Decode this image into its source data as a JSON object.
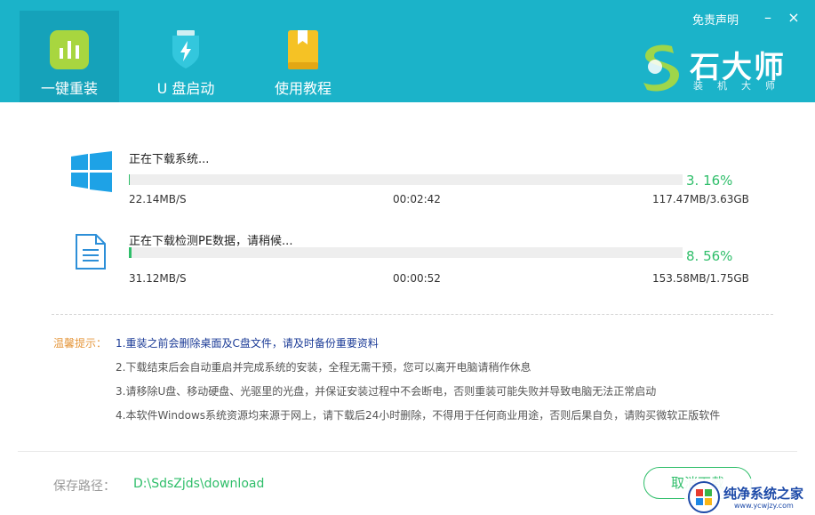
{
  "header": {
    "tabs": [
      {
        "label": "一键重装",
        "icon": "bar-chart-icon",
        "active": true
      },
      {
        "label": "U 盘启动",
        "icon": "usb-shield-icon",
        "active": false
      },
      {
        "label": "使用教程",
        "icon": "book-icon",
        "active": false
      }
    ],
    "disclaimer": "免责声明",
    "minimize": "–",
    "close": "×",
    "logo": {
      "brand": "石大师",
      "sub": "装机大师"
    }
  },
  "downloads": [
    {
      "title": "正在下载系统...",
      "icon": "windows-logo-icon",
      "percent_text": "3. 16%",
      "progress": 0.0316,
      "speed": "22.14MB/S",
      "time": "00:02:42",
      "size": "117.47MB/3.63GB"
    },
    {
      "title": "正在下载检测PE数据，请稍候...",
      "icon": "document-icon",
      "percent_text": "8. 56%",
      "progress": 0.0856,
      "speed": "31.12MB/S",
      "time": "00:00:52",
      "size": "153.58MB/1.75GB"
    }
  ],
  "tips": {
    "label": "温馨提示：",
    "items": [
      "1.重装之前会删除桌面及C盘文件，请及时备份重要资料",
      "2.下载结束后会自动重启并完成系统的安装，全程无需干预，您可以离开电脑请稍作休息",
      "3.请移除U盘、移动硬盘、光驱里的光盘，并保证安装过程中不会断电，否则重装可能失败并导致电脑无法正常启动",
      "4.本软件Windows系统资源均来源于网上，请下载后24小时删除，不得用于任何商业用途，否则后果自负，请购买微软正版软件"
    ]
  },
  "footer": {
    "path_label": "保存路径：",
    "path_value": "D:\\SdsZjds\\download",
    "cancel_label": "取消下载"
  },
  "watermark": {
    "text": "纯净系统之家",
    "url": "www.ycwjzy.com"
  },
  "colors": {
    "header_bg": "#1bb3c9",
    "active_tab_bg": "#15a2ba",
    "accent_green": "#2fbe6a",
    "tip_label_orange": "#e5973c",
    "tip_first_blue": "#1a3a96"
  }
}
